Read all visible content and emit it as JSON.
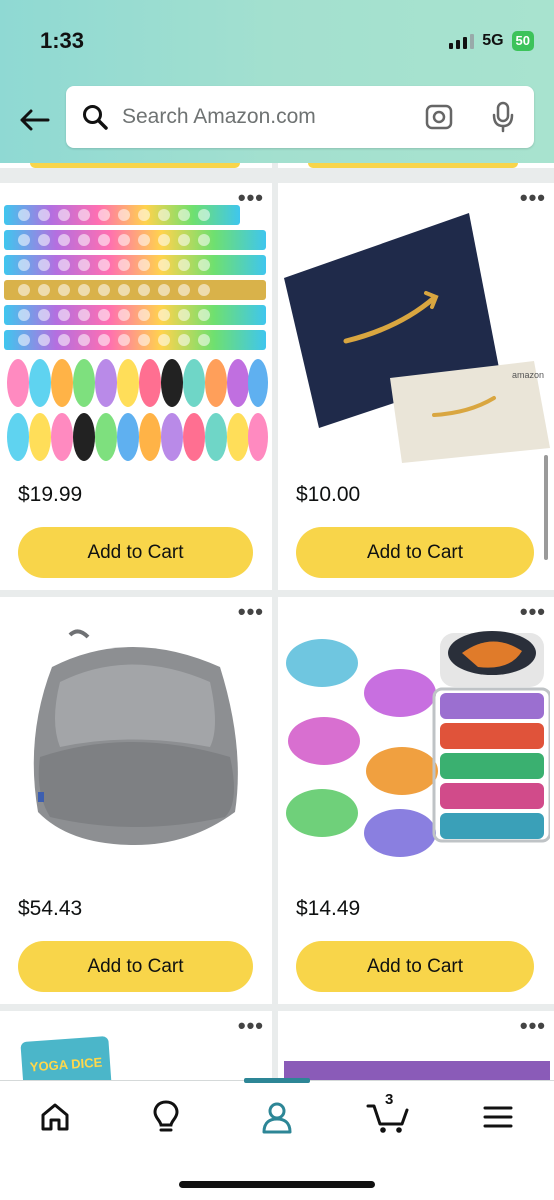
{
  "status_bar": {
    "time": "1:33",
    "network": "5G",
    "battery": "50"
  },
  "search": {
    "placeholder": "Search Amazon.com"
  },
  "icons": {
    "back": "arrow-left-icon",
    "search": "magnifier-icon",
    "camera": "camera-icon",
    "mic": "microphone-icon"
  },
  "products": [
    {
      "name": "pop-it-bracelets",
      "price": "$19.99",
      "button": "Add to Cart"
    },
    {
      "name": "amazon-gift-card",
      "price": "$10.00",
      "button": "Add to Cart"
    },
    {
      "name": "gray-bean-bag-chair",
      "price": "$54.43",
      "button": "Add to Cart"
    },
    {
      "name": "fluffy-putty-set",
      "price": "$14.49",
      "button": "Add to Cart"
    }
  ],
  "partial_products": [
    {
      "name": "yoga-dice",
      "label": "YOGA DICE"
    },
    {
      "name": "purple-box-item"
    }
  ],
  "tabs": [
    {
      "name": "home",
      "icon": "home-icon"
    },
    {
      "name": "inspire",
      "icon": "lightbulb-icon"
    },
    {
      "name": "account",
      "icon": "person-icon",
      "active": true
    },
    {
      "name": "cart",
      "icon": "cart-icon",
      "count": "3"
    },
    {
      "name": "menu",
      "icon": "menu-icon"
    }
  ],
  "colors": {
    "accent": "#f8d54a",
    "tab_active": "#2d8696",
    "header_start": "#8fd9d3",
    "header_end": "#a8e3cf"
  }
}
